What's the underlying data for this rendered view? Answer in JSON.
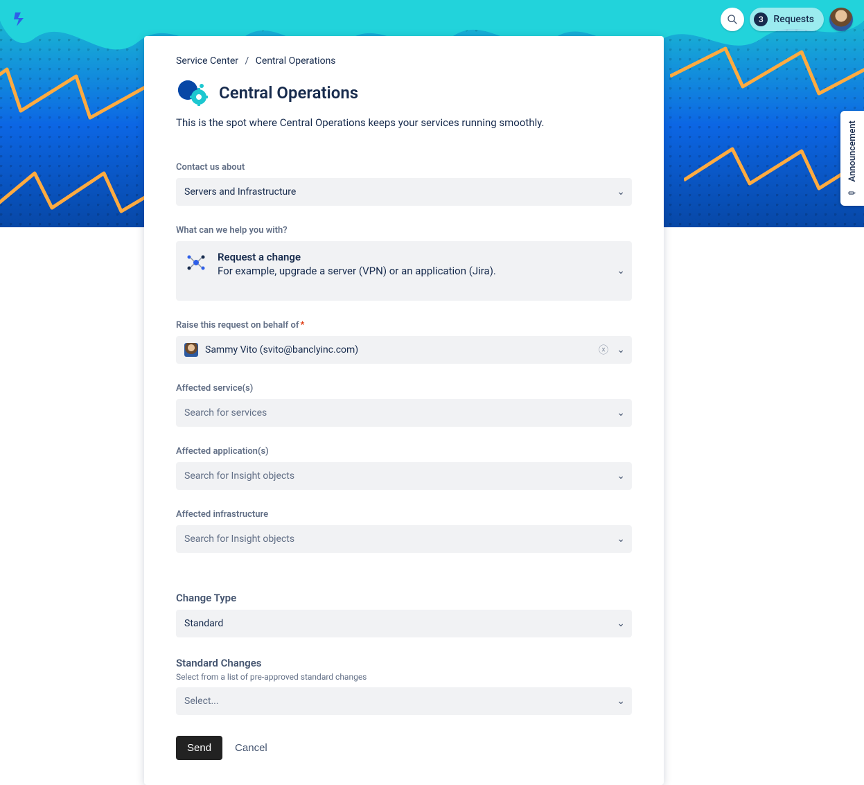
{
  "topbar": {
    "requests_count": "3",
    "requests_label": "Requests"
  },
  "announcement_label": "Announcement",
  "breadcrumb": {
    "root": "Service Center",
    "current": "Central Operations"
  },
  "page": {
    "title": "Central Operations",
    "description": "This is the spot where Central Operations keeps your services running smoothly."
  },
  "form": {
    "contact_label": "Contact us about",
    "contact_value": "Servers and Infrastructure",
    "help_label": "What can we help you with?",
    "help_title": "Request a change",
    "help_desc": "For example, upgrade a server (VPN) or an application (Jira).",
    "behalf_label": "Raise this request on behalf of",
    "behalf_value": "Sammy Vito (svito@banclyinc.com)",
    "services_label": "Affected service(s)",
    "services_placeholder": "Search for services",
    "applications_label": "Affected application(s)",
    "applications_placeholder": "Search for Insight objects",
    "infrastructure_label": "Affected infrastructure",
    "infrastructure_placeholder": "Search for Insight objects",
    "change_type_label": "Change Type",
    "change_type_value": "Standard",
    "standard_changes_label": "Standard Changes",
    "standard_changes_sublabel": "Select from a list of pre-approved standard changes",
    "standard_changes_placeholder": "Select...",
    "send": "Send",
    "cancel": "Cancel"
  }
}
